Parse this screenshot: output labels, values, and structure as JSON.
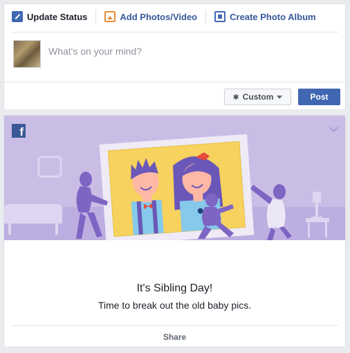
{
  "composer": {
    "tabs": [
      {
        "label": "Update Status",
        "icon": "pencil-icon"
      },
      {
        "label": "Add Photos/Video",
        "icon": "photo-icon"
      },
      {
        "label": "Create Photo Album",
        "icon": "album-icon"
      }
    ],
    "placeholder": "What's on your mind?",
    "audience_label": "Custom",
    "post_label": "Post"
  },
  "card": {
    "logo": "f",
    "title": "It's Sibling Day!",
    "subtitle": "Time to break out the old baby pics.",
    "share_label": "Share"
  },
  "colors": {
    "brand": "#4267b2",
    "banner_bg": "#c9bde6",
    "banner_floor": "#b7a8de",
    "frame_yellow": "#f7d25e",
    "figure_purple": "#7e64c3"
  }
}
